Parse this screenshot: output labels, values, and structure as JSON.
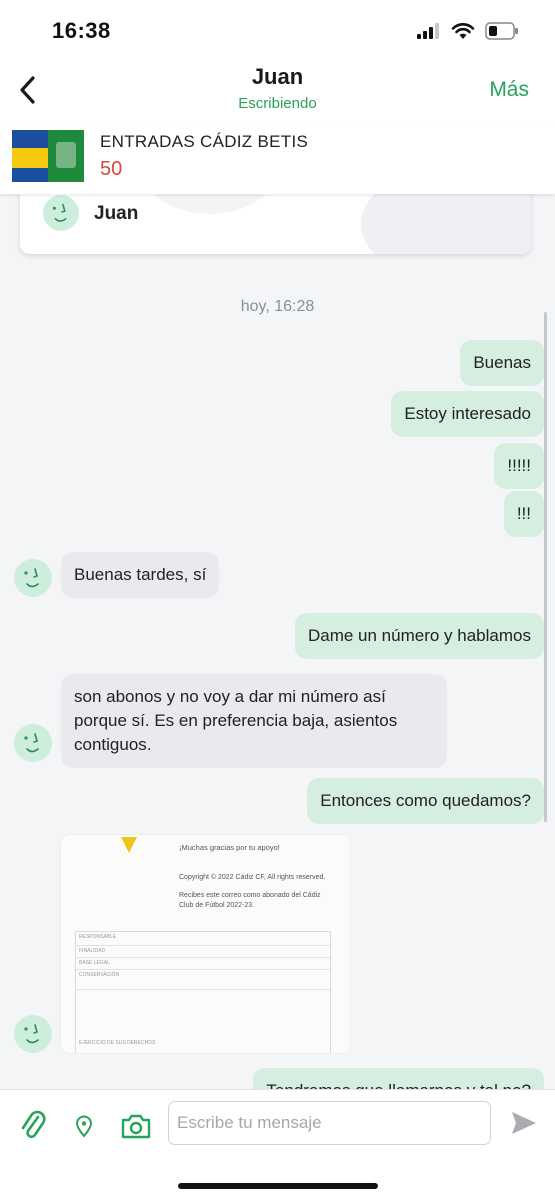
{
  "status_bar": {
    "time": "16:38"
  },
  "header": {
    "contact_name": "Juan",
    "contact_status": "Escribiendo",
    "more_label": "Más"
  },
  "listing": {
    "title": "ENTRADAS CÁDIZ BETIS",
    "price": "50"
  },
  "profile_card": {
    "name": "Juan"
  },
  "chat": {
    "date_separator": "hoy, 16:28",
    "messages": [
      {
        "side": "out",
        "text": "Buenas"
      },
      {
        "side": "out",
        "text": "Estoy interesado"
      },
      {
        "side": "out",
        "text": "!!!!!"
      },
      {
        "side": "out",
        "text": "!!!"
      },
      {
        "side": "in",
        "text": "Buenas tardes, sí"
      },
      {
        "side": "out",
        "text": "Dame un número y hablamos"
      },
      {
        "side": "in",
        "text": "son abonos y no voy a dar mi número así\nporque sí. Es en preferencia baja, asientos\ncontiguos."
      },
      {
        "side": "out",
        "text": "Entonces como quedamos?"
      },
      {
        "side": "out",
        "text": "Tendremos que llamarnos y tal no?"
      }
    ],
    "image_message": {
      "line1": "¡Muchas gracias por tu apoyo!",
      "line2": "Copyright © 2022 Cádiz CF, All rights reserved.",
      "line3": "Recibes este correo como abonado del Cádiz\nClub de Fútbol 2022-23.",
      "rows": [
        "RESPONSABLE",
        "FINALIDAD",
        "BASE LEGAL",
        "CONSERVACIÓN",
        "EJERCICIO DE SUS DERECHOS"
      ]
    }
  },
  "input": {
    "placeholder": "Escribe tu mensaje"
  },
  "colors": {
    "accent": "#27a35a",
    "price": "#d9473b",
    "outgoing_bubble": "#d5eee0",
    "incoming_bubble": "#e8eaed"
  }
}
